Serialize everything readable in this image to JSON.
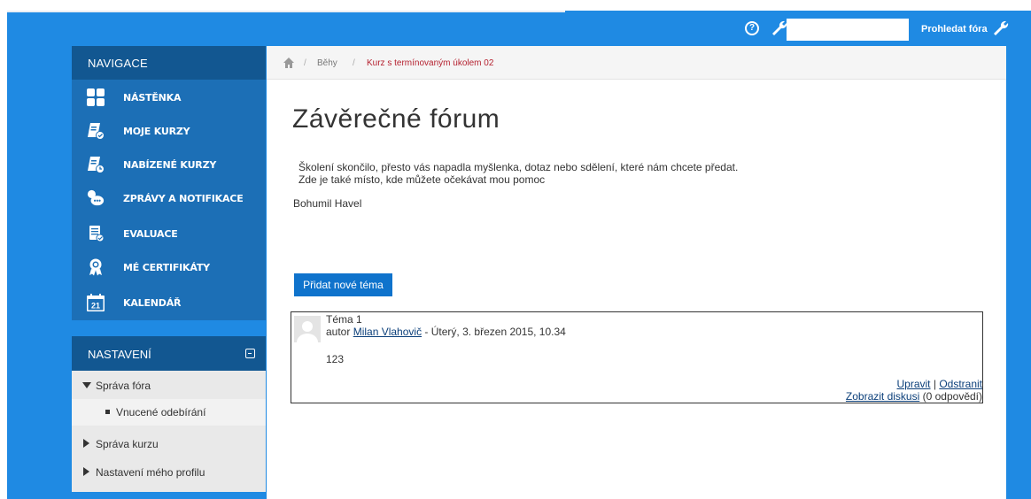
{
  "topbar": {
    "search_placeholder": "",
    "search_button": "Prohledat fóra"
  },
  "nav": {
    "heading": "NAVIGACE",
    "items": [
      {
        "label": "NÁSTĚNKA",
        "icon": "dashboard-icon"
      },
      {
        "label": "MOJE KURZY",
        "icon": "my-courses-icon"
      },
      {
        "label": "NABÍZENÉ KURZY",
        "icon": "offered-courses-icon"
      },
      {
        "label": "ZPRÁVY A NOTIFIKACE",
        "icon": "messages-icon"
      },
      {
        "label": "EVALUACE",
        "icon": "evaluation-icon"
      },
      {
        "label": "MÉ CERTIFIKÁTY",
        "icon": "certificate-icon"
      },
      {
        "label": "KALENDÁŘ",
        "icon": "calendar-icon",
        "day": "21"
      }
    ]
  },
  "settings": {
    "heading": "NASTAVENÍ",
    "items": [
      {
        "label": "Správa fóra",
        "state": "expanded"
      },
      {
        "label": "Vnucené odebírání",
        "state": "child"
      },
      {
        "label": "Správa kurzu",
        "state": "collapsed"
      },
      {
        "label": "Nastavení mého profilu",
        "state": "collapsed"
      }
    ]
  },
  "breadcrumb": {
    "sep": "/",
    "items": [
      "Běhy",
      "Kurz s termínovaným úkolem 02"
    ]
  },
  "page": {
    "title": "Závěrečné fórum",
    "intro_line1": "Školení skončilo, přesto vás napadla myšlenka, dotaz nebo sdělení, které nám chcete předat.",
    "intro_line2": "Zde je také místo, kde můžete očekávat mou pomoc",
    "signature": "Bohumil Havel",
    "add_button": "Přidat nové téma"
  },
  "post": {
    "subject": "Téma 1",
    "author_prefix": "autor",
    "author": "Milan Vlahovič",
    "date": " - Úterý, 3. březen 2015, 10.34",
    "body": "123",
    "edit": "Upravit",
    "divider": " | ",
    "delete": "Odstranit",
    "show_discussion": "Zobrazit diskusi",
    "replies": " (0 odpovědí)"
  },
  "colors": {
    "frame": "#1f8ae3",
    "nav_bg": "#1c6fb6",
    "nav_head": "#125791",
    "button": "#0f73cc",
    "crumb_active": "#b52230"
  }
}
